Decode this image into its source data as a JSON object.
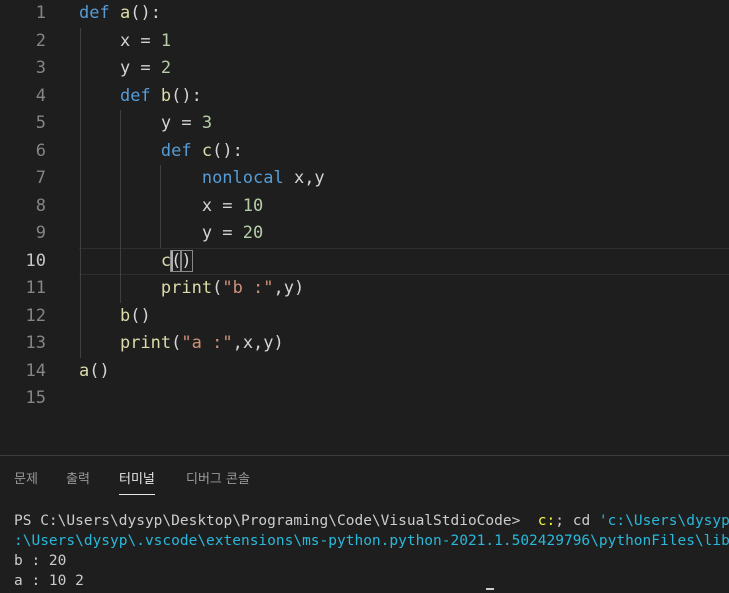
{
  "editor": {
    "line_numbers": [
      "1",
      "2",
      "3",
      "4",
      "5",
      "6",
      "7",
      "8",
      "9",
      "10",
      "11",
      "12",
      "13",
      "14",
      "15"
    ],
    "current_line": "10",
    "lines": [
      [
        {
          "t": "def",
          "c": "kw"
        },
        {
          "t": " "
        },
        {
          "t": "a",
          "c": "fn"
        },
        {
          "t": "():"
        }
      ],
      [
        {
          "t": "    x = "
        },
        {
          "t": "1",
          "c": "nm"
        }
      ],
      [
        {
          "t": "    y = "
        },
        {
          "t": "2",
          "c": "nm"
        }
      ],
      [
        {
          "t": "    "
        },
        {
          "t": "def",
          "c": "kw"
        },
        {
          "t": " "
        },
        {
          "t": "b",
          "c": "fn"
        },
        {
          "t": "():"
        }
      ],
      [
        {
          "t": "        y = "
        },
        {
          "t": "3",
          "c": "nm"
        }
      ],
      [
        {
          "t": "        "
        },
        {
          "t": "def",
          "c": "kw"
        },
        {
          "t": " "
        },
        {
          "t": "c",
          "c": "fn"
        },
        {
          "t": "():"
        }
      ],
      [
        {
          "t": "            "
        },
        {
          "t": "nonlocal",
          "c": "kw"
        },
        {
          "t": " x,y"
        }
      ],
      [
        {
          "t": "            x = "
        },
        {
          "t": "10",
          "c": "nm"
        }
      ],
      [
        {
          "t": "            y = "
        },
        {
          "t": "20",
          "c": "nm"
        }
      ],
      [
        {
          "t": "        "
        },
        {
          "t": "c",
          "c": "fn"
        },
        {
          "t": "(",
          "c": "br-match"
        },
        {
          "t": ")",
          "c": "br-match"
        }
      ],
      [
        {
          "t": "        "
        },
        {
          "t": "print",
          "c": "fn"
        },
        {
          "t": "("
        },
        {
          "t": "\"b :\"",
          "c": "st"
        },
        {
          "t": ",y)"
        }
      ],
      [
        {
          "t": "    "
        },
        {
          "t": "b",
          "c": "fn"
        },
        {
          "t": "()"
        }
      ],
      [
        {
          "t": "    "
        },
        {
          "t": "print",
          "c": "fn"
        },
        {
          "t": "("
        },
        {
          "t": "\"a :\"",
          "c": "st"
        },
        {
          "t": ",x,y)"
        }
      ],
      [
        {
          "t": "a",
          "c": "fn"
        },
        {
          "t": "()"
        }
      ],
      []
    ]
  },
  "panel": {
    "tabs": [
      {
        "label": "문제",
        "active": false
      },
      {
        "label": "출력",
        "active": false
      },
      {
        "label": "터미널",
        "active": true
      },
      {
        "label": "디버그 콘솔",
        "active": false
      }
    ],
    "terminal": {
      "prompt": "PS C:\\Users\\dysyp\\Desktop\\Programing\\Code\\VisualStdioCode> ",
      "command_part1": " c:",
      "command_part2": "; cd ",
      "command_part3": "'c:\\Users\\dysyp\\Desktop",
      "line2": ":\\Users\\dysyp\\.vscode\\extensions\\ms-python.python-2021.1.502429796\\pythonFiles\\lib\\python\\",
      "output": [
        "b : 20",
        "a : 10 2"
      ]
    }
  }
}
